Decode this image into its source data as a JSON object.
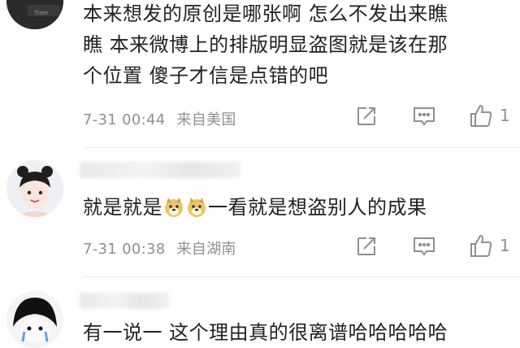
{
  "comments": [
    {
      "text_lines": [
        "本来想发的原创是哪张啊 怎么不发出来瞧",
        "瞧 本来微博上的排版明显盗图就是该在那",
        "个位置 傻子才信是点错的吧"
      ],
      "time": "7-31 00:44",
      "location": "来自美国",
      "like_count": "1"
    },
    {
      "text_before_emoji": "就是就是",
      "emoji": [
        "doge-emoji",
        "doge-emoji"
      ],
      "text_after_emoji": "一看就是想盗别人的成果",
      "time": "7-31 00:38",
      "location": "来自湖南",
      "like_count": "1"
    },
    {
      "text_lines": [
        "有一说一 这个理由真的很离谱哈哈哈哈哈"
      ]
    }
  ]
}
